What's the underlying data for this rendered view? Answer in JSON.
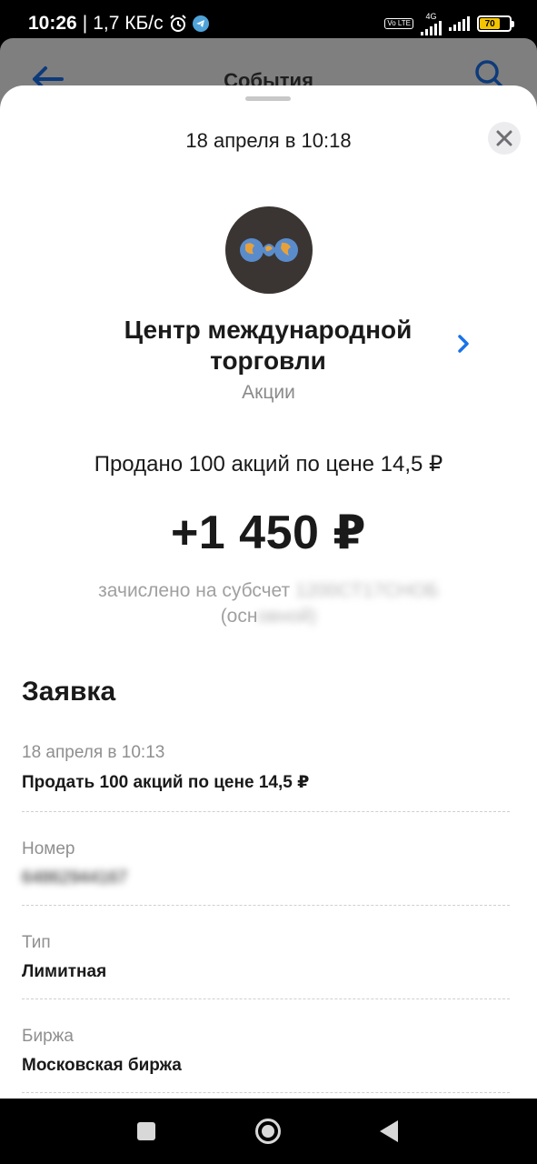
{
  "status_bar": {
    "time": "10:26",
    "speed": "1,7 КБ/с",
    "network": "4G",
    "volte": "Vo LTE",
    "battery": "70"
  },
  "background_app": {
    "title": "События"
  },
  "sheet": {
    "date": "18 апреля в 10:18",
    "company_name": "Центр международной торговли",
    "company_type": "Акции",
    "sold_text": "Продано 100 акций по цене 14,5 ₽",
    "amount": "+1 450 ₽",
    "credited_prefix": "зачислено на субсчет",
    "credited_hidden": "1200СТ17СНОБ",
    "credited_suffix_open": "(осн",
    "credited_suffix_hidden": "овной)",
    "section_title": "Заявка",
    "details": [
      {
        "label": "18 апреля в 10:13",
        "value": "Продать 100 акций по цене 14,5 ₽"
      },
      {
        "label": "Номер",
        "value": "64862944167"
      },
      {
        "label": "Тип",
        "value": "Лимитная"
      },
      {
        "label": "Биржа",
        "value": "Московская биржа"
      }
    ]
  },
  "colors": {
    "accent": "#1a73e8",
    "logo_bg": "#3a3532",
    "battery": "#f5c400"
  }
}
